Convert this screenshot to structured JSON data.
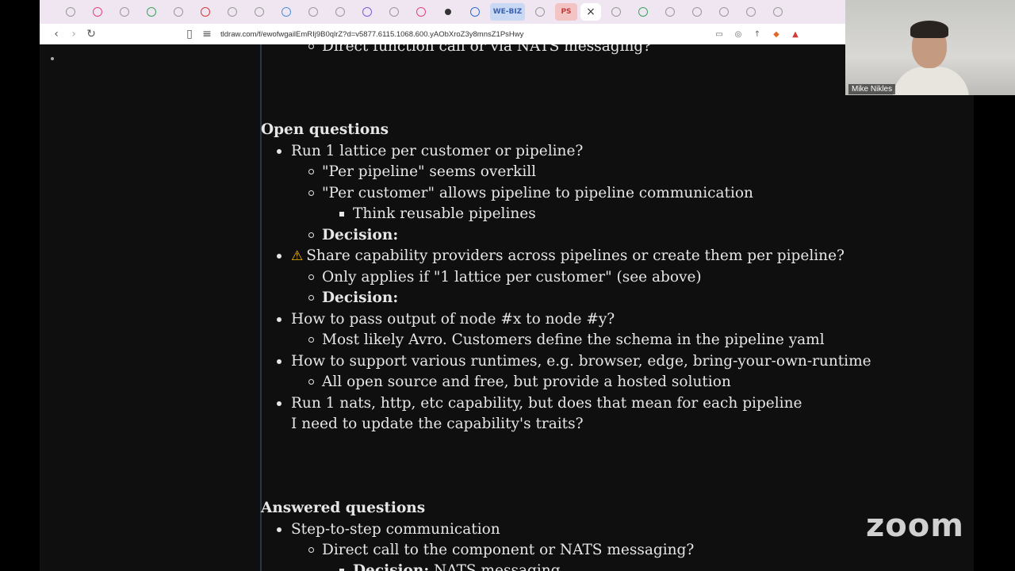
{
  "browser": {
    "tabs": [
      {
        "icon": "tab-icon"
      },
      {
        "icon": "tab-icon"
      },
      {
        "icon": "tab-icon"
      },
      {
        "icon": "tab-icon"
      },
      {
        "icon": "tab-icon"
      },
      {
        "icon": "tab-icon"
      },
      {
        "icon": "tab-icon"
      },
      {
        "icon": "tab-icon"
      },
      {
        "icon": "tab-icon"
      },
      {
        "icon": "tab-icon"
      },
      {
        "icon": "tab-icon"
      },
      {
        "icon": "tab-icon"
      },
      {
        "icon": "tab-icon"
      },
      {
        "icon": "tab-icon"
      },
      {
        "icon": "tab-icon"
      },
      {
        "icon": "tab-icon"
      },
      {
        "label": "WE-BIZ"
      },
      {
        "icon": "tab-icon"
      },
      {
        "label": "PS"
      },
      {
        "close": "×"
      }
    ],
    "url": "tldraw.com/f/ewofwgailEmRIj9B0qlrZ?d=v5877.6115.1068.600.yAObXroZ3y8mnsZ1PsHwy"
  },
  "document": {
    "top_partial": "Direct function call or via NATS messaging?",
    "open_questions": {
      "heading": "Open questions",
      "q1": "Run 1 lattice per customer or pipeline?",
      "q1_a": "\"Per pipeline\" seems overkill",
      "q1_b": "\"Per customer\" allows pipeline to pipeline communication",
      "q1_b_sub": "Think reusable pipelines",
      "q1_decision": "Decision:",
      "q2": "Share capability providers across pipelines or create them per pipeline?",
      "q2_a": "Only applies if \"1 lattice per customer\" (see above)",
      "q2_decision": "Decision:",
      "q3": "How to pass output of node #x to node #y?",
      "q3_a": "Most likely Avro. Customers define the schema in the pipeline yaml",
      "q4": "How to support various runtimes, e.g. browser, edge, bring-your-own-runtime",
      "q4_a": "All open source and free, but provide a hosted solution",
      "q5_line1": "Run 1 nats, http, etc capability, but does that mean for each pipeline",
      "q5_line2": "I need to update the capability's traits?"
    },
    "answered_questions": {
      "heading": "Answered questions",
      "q1": "Step-to-step communication",
      "q1_a": "Direct call to the component or NATS messaging?",
      "q1_decision_label": "Decision:",
      "q1_decision_value": " NATS messaging"
    }
  },
  "video": {
    "participant_name": "Mike Nikles"
  },
  "zoom_logo": "zoom",
  "colors": {
    "background": "#0f0f0f",
    "text": "#e6e6e6",
    "warning": "#f0b400"
  }
}
